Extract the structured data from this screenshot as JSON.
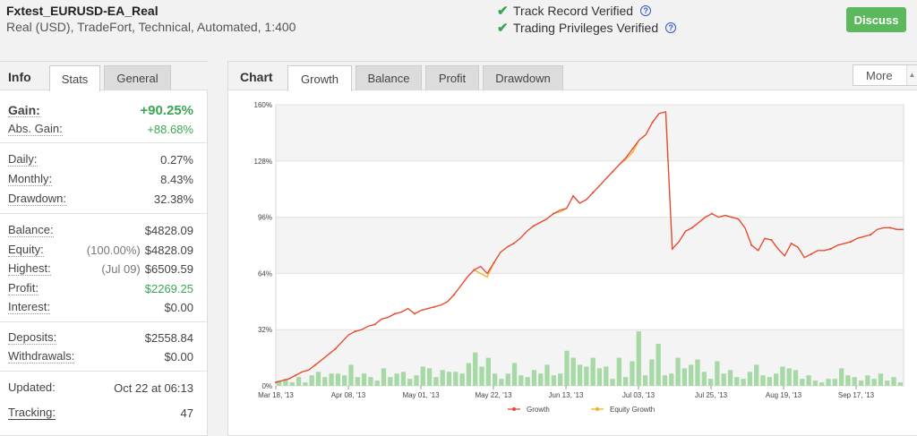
{
  "header": {
    "account_name": "Fxtest_EURUSD-EA_Real",
    "account_desc": "Real (USD), TradeFort, Technical, Automated, 1:400",
    "verified": [
      {
        "label": "Track Record Verified",
        "icon": "check-icon"
      },
      {
        "label": "Trading Privileges Verified",
        "icon": "check-icon"
      }
    ],
    "discuss_label": "Discuss",
    "colors": {
      "accent": "#5cb85c",
      "check": "#3aa655"
    }
  },
  "left_panel": {
    "title": "Info",
    "tabs": [
      "Stats",
      "General"
    ],
    "active_tab": "Stats",
    "stats": {
      "gain": {
        "label": "Gain:",
        "value": "+90.25%"
      },
      "abs_gain": {
        "label": "Abs. Gain:",
        "value": "+88.68%"
      },
      "daily": {
        "label": "Daily:",
        "value": "0.27%"
      },
      "monthly": {
        "label": "Monthly:",
        "value": "8.43%"
      },
      "drawdown": {
        "label": "Drawdown:",
        "value": "32.38%"
      },
      "balance": {
        "label": "Balance:",
        "value": "$4828.09"
      },
      "equity": {
        "label": "Equity:",
        "sub": "(100.00%)",
        "value": "$4828.09"
      },
      "highest": {
        "label": "Highest:",
        "sub": "(Jul 09)",
        "value": "$6509.59"
      },
      "profit": {
        "label": "Profit:",
        "value": "$2269.25"
      },
      "interest": {
        "label": "Interest:",
        "value": "$0.00"
      },
      "deposits": {
        "label": "Deposits:",
        "value": "$2558.84"
      },
      "withdrawals": {
        "label": "Withdrawals:",
        "value": "$0.00"
      },
      "updated": {
        "label": "Updated:",
        "value": "Oct 22 at 06:13"
      },
      "tracking": {
        "label": "Tracking:",
        "value": "47"
      }
    }
  },
  "chart_panel": {
    "title": "Chart",
    "tabs": [
      "Growth",
      "Balance",
      "Profit",
      "Drawdown"
    ],
    "active_tab": "Growth",
    "more_label": "More"
  },
  "chart_data": {
    "type": "line",
    "x_tick_labels": [
      "Mar 18, '13",
      "Apr 08, '13",
      "May 01, '13",
      "May 22, '13",
      "Jun 13, '13",
      "Jul 03, '13",
      "Jul 25, '13",
      "Aug 19, '13",
      "Sep 17, '13"
    ],
    "y_tick_labels": [
      "0%",
      "32%",
      "64%",
      "96%",
      "128%",
      "160%"
    ],
    "ylim": [
      0,
      160
    ],
    "grid": true,
    "legend_position": "bottom",
    "series": [
      {
        "name": "Growth",
        "color": "#e8473a",
        "values": [
          2,
          3,
          4,
          6,
          8,
          9,
          12,
          15,
          18,
          21,
          25,
          29,
          31,
          32,
          34,
          35,
          38,
          39,
          41,
          42,
          44,
          41,
          43,
          44,
          45,
          46,
          48,
          52,
          57,
          62,
          66,
          68,
          64,
          70,
          76,
          79,
          81,
          84,
          88,
          91,
          93,
          95,
          98,
          100,
          101,
          108,
          104,
          106,
          110,
          114,
          118,
          122,
          126,
          130,
          135,
          140,
          143,
          150,
          155,
          156,
          78,
          82,
          88,
          90,
          93,
          96,
          98,
          96,
          97,
          96,
          95,
          90,
          80,
          77,
          84,
          83,
          78,
          74,
          81,
          79,
          73,
          75,
          77,
          77,
          78,
          80,
          81,
          82,
          84,
          85,
          86,
          89,
          90,
          90,
          89,
          89
        ]
      },
      {
        "name": "Equity Growth",
        "color": "#f0b020",
        "values": [
          2,
          3,
          4,
          6,
          8,
          9,
          12,
          15,
          18,
          21,
          25,
          29,
          31,
          32,
          34,
          35,
          38,
          39,
          41,
          42,
          44,
          41,
          43,
          44,
          45,
          46,
          48,
          52,
          57,
          62,
          66,
          64,
          62,
          70,
          76,
          79,
          81,
          84,
          88,
          91,
          93,
          95,
          98,
          99,
          101,
          108,
          104,
          106,
          110,
          114,
          118,
          122,
          126,
          129,
          133,
          140,
          143,
          150,
          155,
          156,
          78,
          82,
          88,
          90,
          93,
          96,
          98,
          96,
          97,
          96,
          95,
          90,
          80,
          77,
          84,
          83,
          78,
          74,
          81,
          79,
          73,
          75,
          77,
          77,
          78,
          80,
          81,
          82,
          84,
          85,
          86,
          89,
          90,
          90,
          89,
          89
        ]
      },
      {
        "name": "Daily profit bars",
        "color": "#a6d9a6",
        "values": [
          3,
          4,
          2,
          5,
          2,
          6,
          8,
          5,
          7,
          7,
          6,
          12,
          5,
          7,
          5,
          3,
          10,
          5,
          7,
          8,
          4,
          6,
          11,
          10,
          5,
          9,
          8,
          8,
          7,
          13,
          19,
          11,
          16,
          7,
          4,
          7,
          13,
          6,
          5,
          9,
          7,
          12,
          6,
          7,
          20,
          16,
          12,
          11,
          16,
          10,
          11,
          4,
          16,
          5,
          14,
          31,
          6,
          15,
          24,
          6,
          7,
          16,
          10,
          12,
          15,
          8,
          4,
          14,
          7,
          9,
          5,
          4,
          8,
          12,
          6,
          5,
          7,
          11,
          10,
          9,
          4,
          6,
          3,
          2,
          4,
          4,
          10,
          6,
          5,
          3,
          6,
          4,
          7,
          3,
          5,
          2
        ]
      }
    ]
  }
}
